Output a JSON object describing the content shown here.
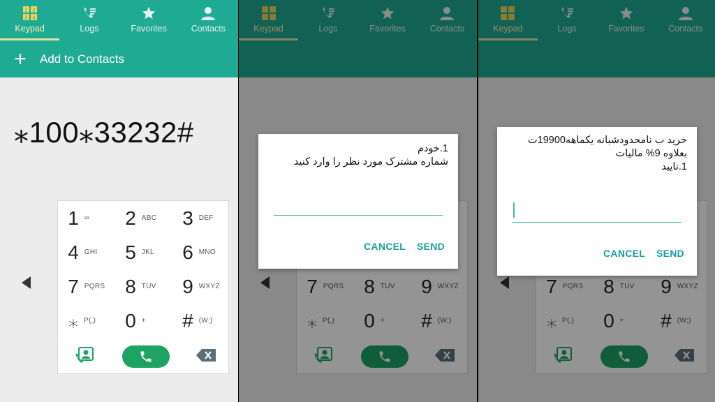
{
  "tabs": [
    {
      "label": "Keypad",
      "icon": "keypad-icon"
    },
    {
      "label": "Logs",
      "icon": "logs-icon"
    },
    {
      "label": "Favorites",
      "icon": "star-icon"
    },
    {
      "label": "Contacts",
      "icon": "contacts-icon"
    }
  ],
  "actionbar": {
    "add_to_contacts": "Add to Contacts"
  },
  "dial_number": "⁎100⁎33232#",
  "keys": [
    {
      "digit": "1",
      "sub": "∞"
    },
    {
      "digit": "2",
      "sub": "ABC"
    },
    {
      "digit": "3",
      "sub": "DEF"
    },
    {
      "digit": "4",
      "sub": "GHI"
    },
    {
      "digit": "5",
      "sub": "JKL"
    },
    {
      "digit": "6",
      "sub": "MNO"
    },
    {
      "digit": "7",
      "sub": "PQRS"
    },
    {
      "digit": "8",
      "sub": "TUV"
    },
    {
      "digit": "9",
      "sub": "WXYZ"
    },
    {
      "digit": "⁎",
      "sub": "P(,)"
    },
    {
      "digit": "0",
      "sub": "+"
    },
    {
      "digit": "#",
      "sub": "(W;)"
    }
  ],
  "dialog1": {
    "message": "1.خودم\nشماره مشترک مورد نظر را وارد کنید",
    "cancel": "CANCEL",
    "send": "SEND"
  },
  "dialog2": {
    "message": "خرید ب نامحدودشبانه یکماهه19900ت\nبعلاوه 9% مالیات\n1.تایید",
    "cancel": "CANCEL",
    "send": "SEND"
  },
  "colors": {
    "brand": "#1eaa93",
    "call": "#1da363",
    "accent": "#1a9fa0"
  }
}
